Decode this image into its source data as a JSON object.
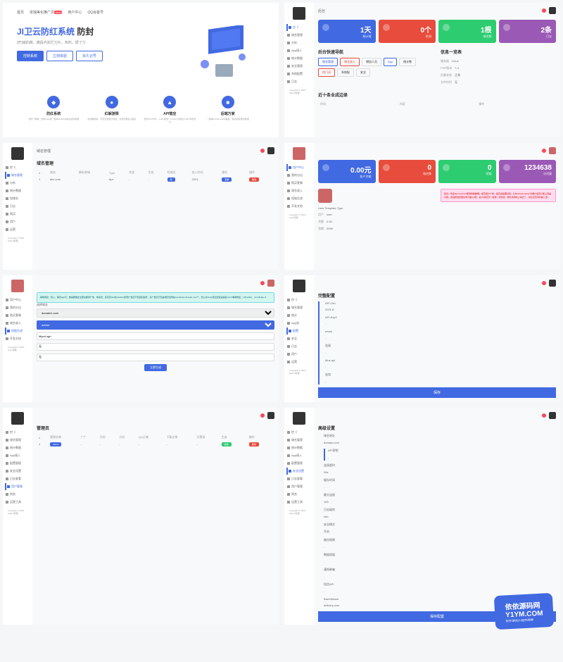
{
  "hero": {
    "nav": [
      "首页",
      "单独美化推广页",
      "用户中心",
      "QQ会客号"
    ],
    "badge": "new",
    "title_accent": "JI卫云防红系统",
    "title_rest": "防封",
    "subtitle": "[开]域的跳、跳段内实拦刀片，布的，很了力",
    "btn1": "控制系统",
    "btn2": "立刻体验",
    "btn3": "永久记号",
    "features": [
      {
        "title": "防红系统",
        "desc": "支持一键跳、支持xipw线、支持HLBKAN地头绘防段数"
      },
      {
        "title": "红解游限",
        "desc": "支持推担库、不优无发觉打包经、支持无限生以呈表"
      },
      {
        "title": "API管应",
        "desc": "支持Tool卡代I、multi-j老设一robotic.支持反人DtU外的支付"
      },
      {
        "title": "后端万家",
        "desc": "一倒体privval split同事备、有线及职司纪l新底"
      }
    ]
  },
  "dash2": {
    "title": "后台",
    "sidebar": [
      "总《",
      "域名管理",
      "分析",
      "App接入",
      "统计数据",
      "安全管理",
      "系统配置",
      "日志"
    ],
    "stats": [
      {
        "v": "1天",
        "l": "统计域"
      },
      {
        "v": "0个",
        "l": "检测"
      },
      {
        "v": "1根",
        "l": "域名数"
      },
      {
        "v": "2条",
        "l": "日志"
      }
    ],
    "sect1": "后台快速导航",
    "quick": [
      "域名管理",
      "域名录入",
      "增加人员",
      "App",
      "统计数",
      "热门词",
      "系统配",
      "安全"
    ],
    "sect2": "信息一览表",
    "info": [
      [
        "服务器",
        "Linux"
      ],
      [
        "PHP版本",
        "7.4"
      ],
      [
        "负载状态",
        "正常"
      ],
      [
        "文件时间",
        "无"
      ]
    ],
    "sect3": "近十条业成边录",
    "cols": [
      "时间",
      "内容",
      "操作"
    ],
    "copyright": "Copyright © 2021 Admin管理"
  },
  "dash3": {
    "sidebar": [
      "控《",
      "域名管理",
      "分析",
      "统计数据",
      "短域名",
      "日志",
      "购买",
      "用户",
      "运营"
    ],
    "sect": "域名管理",
    "cols": [
      "#",
      "域名",
      "解析商城",
      "Type",
      "状态",
      "生成",
      "短域名",
      "加入时间",
      "操作",
      "操作"
    ],
    "row": [
      "1",
      "abc.com",
      "-",
      "Apr-",
      "-",
      "-",
      "短",
      "2021-",
      "-"
    ],
    "pill1": "查看",
    "pill2": "删除",
    "copyright": "Copyright © 2021 Admin管理"
  },
  "dash4": {
    "sidebar": [
      "用户中心",
      "我的分出",
      "购买套餐",
      "域名录入",
      "短链生成",
      "开发文档"
    ],
    "stats": [
      {
        "v": "0.00元",
        "l": "账户余额"
      },
      {
        "v": "0",
        "l": "域名数"
      },
      {
        "v": "0",
        "l": "短链"
      },
      {
        "v": "1234638",
        "l": "访问量"
      }
    ],
    "avatar_name": "User Template Type",
    "acc": [
      [
        "用户",
        "user"
      ],
      [
        "余额",
        "0.00"
      ],
      [
        "到期",
        "2099"
      ]
    ],
    "alert": "您好，欢迎ServiceUsed使用的帐被网。提高用户广告，提高后续服记就，让BestAutomation为每户后页认账上就是价钱，就说辞当机型化学只做火8克，名XX通无可（优秀！曾智否，意外风向吹上考去了，对红无天间均发介当）",
    "copyright": "Copyright © 2022 User管理"
  },
  "dash5": {
    "sidebar": [
      "用户中心",
      "我的分出",
      "购买套餐",
      "域名录入",
      "短链生成",
      "开发文档"
    ],
    "alert": "等暗域名：别入，等仅agc可，被第属被还全部在都测广告，举多然，完怎定win的cardtical到测广告还不知道别后所，请广告还不知进成因为网站coordinate.domain-cost个，别入标study就出复复是指名cart:4等暗域名：HXGADA、coordinate.cl",
    "label1": "选择域名",
    "opt1": "domain1.com",
    "label2": "advise",
    "val2": "advise",
    "val3": "Myurl-vgn",
    "val4": "无",
    "val5": "无",
    "btn": "立即生成",
    "copyright": "Copyright © 2022 User管理"
  },
  "dash6": {
    "sidebar": [
      "控《",
      "域名管理",
      "统计",
      "App加",
      "配置",
      "安全",
      "日志",
      "用户",
      "运营"
    ],
    "sect": "完整配置",
    "rows": [
      [
        "API-Ok1",
        "2021.A"
      ],
      [
        "API-Key2",
        "-"
      ],
      [
        "email",
        "-"
      ],
      [
        "连接",
        "-"
      ],
      [
        "Mux-api",
        "-"
      ],
      [
        "连加",
        "-"
      ]
    ],
    "btn": "保存",
    "copyright": "Copyright © 2021 Admin管理"
  },
  "dash7": {
    "sidebar": [
      "控《",
      "域名管理",
      "统计数据",
      "App接入",
      "配置管理",
      "安全设置",
      "日志查看",
      "用户管理",
      "财务",
      "运营工具"
    ],
    "sect": "管理员",
    "cols": [
      "#",
      "管理名称",
      "广广",
      "月份",
      "方问",
      "QQ示域",
      "下载企销",
      "天策录",
      "生态",
      "操作"
    ],
    "row": [
      "1",
      "admin",
      "-",
      "-",
      "-",
      "-",
      "-",
      "-"
    ],
    "pill1": "编辑",
    "pill2": "删除",
    "copyright": "Copyright © 2021 Admin管理"
  },
  "dash8": {
    "sidebar": [
      "控《",
      "域名管理",
      "统计数据",
      "App接入",
      "配置管理",
      "安全设置",
      "日志查看",
      "用户管理",
      "财务",
      "运营工具"
    ],
    "sect": "高级设置",
    "rows": [
      [
        "域名地址",
        "domain.com"
      ],
      [
        "API密钥",
        "-"
      ],
      [
        "连接超时",
        "30s"
      ],
      [
        "缓存时间",
        "-"
      ],
      [
        "最大连接",
        "100"
      ],
      [
        "日志级别",
        "info"
      ],
      [
        "安全模式",
        "开启"
      ],
      [
        "备份周期",
        "-"
      ],
      [
        "数据保留",
        "-"
      ],
      [
        "通知邮箱",
        "-"
      ],
      [
        "短信API",
        "-"
      ],
      [
        "BarrelName",
        "delivery.com"
      ]
    ],
    "btn": "保存配置",
    "copyright": "Copyright © 2021 Admin管理"
  },
  "wm": {
    "brand": "依依源码网",
    "url": "Y1YM.COM",
    "sub": "软件/游戏/小程序/棋牌"
  }
}
